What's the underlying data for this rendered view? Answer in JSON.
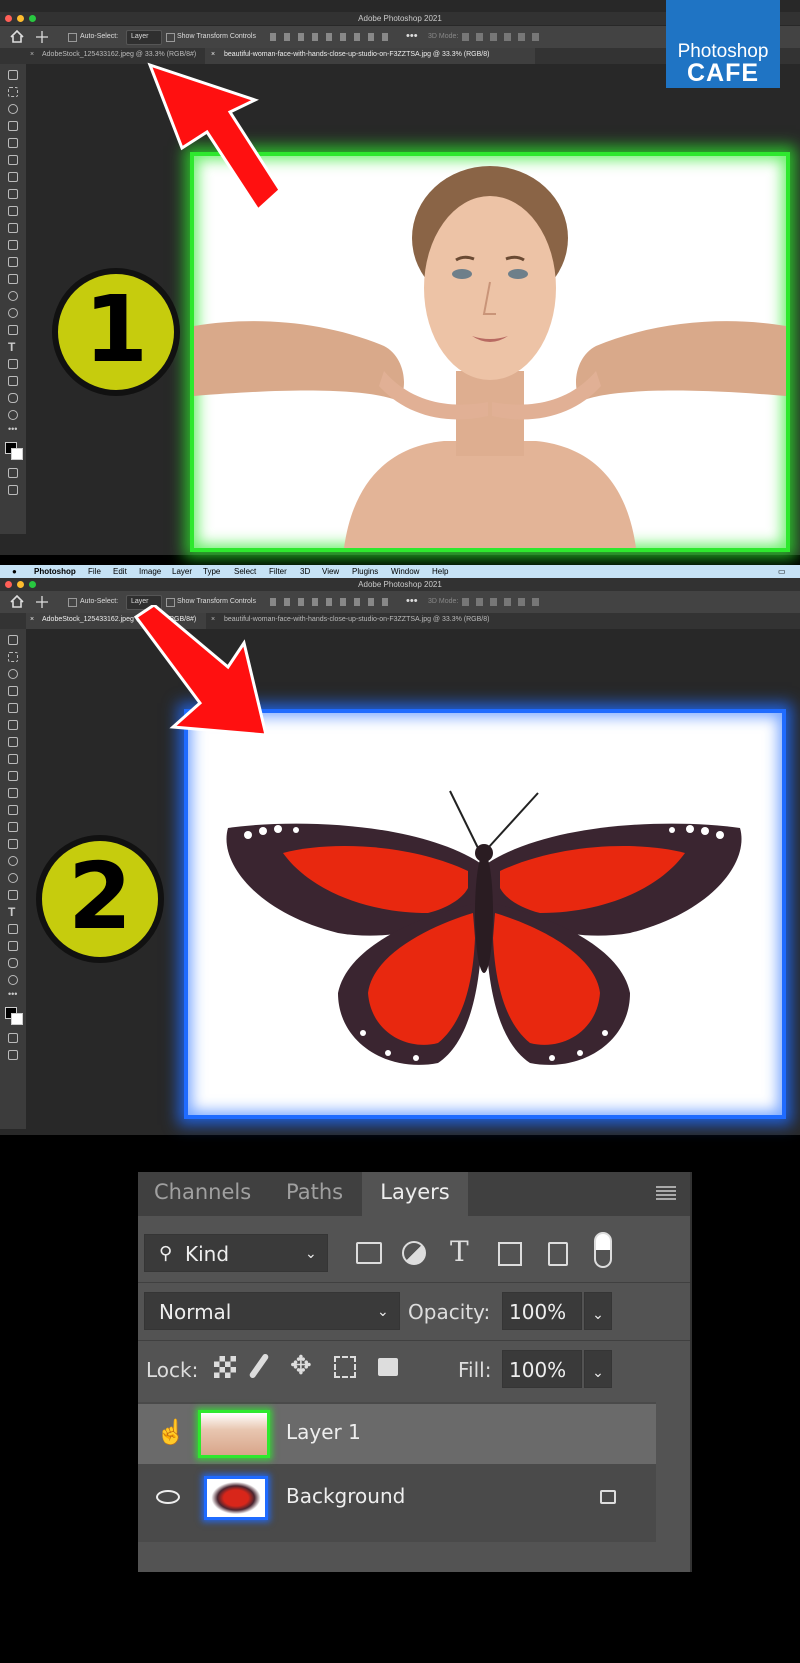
{
  "window_top": {
    "app_title": "Adobe Photoshop 2021",
    "options": {
      "auto_select_label": "Auto-Select:",
      "auto_select_value": "Layer",
      "show_transform_label": "Show Transform Controls",
      "mode_3d_label": "3D Mode:"
    },
    "tabs": [
      "AdobeStock_125433162.jpeg @ 33.3% (RGB/8#)",
      "beautiful-woman-face-with-hands-close-up-studio-on-F3ZZTSA.jpg @ 33.3% (RGB/8)"
    ],
    "active_tab": 1,
    "badge_number": "1",
    "canvas_content": "woman-portrait",
    "highlight_color": "#2ee82e"
  },
  "window_bottom": {
    "app_title": "Adobe Photoshop 2021",
    "menu": [
      "Photoshop",
      "File",
      "Edit",
      "Image",
      "Layer",
      "Type",
      "Select",
      "Filter",
      "3D",
      "View",
      "Plugins",
      "Window",
      "Help"
    ],
    "options": {
      "auto_select_label": "Auto-Select:",
      "auto_select_value": "Layer",
      "show_transform_label": "Show Transform Controls",
      "mode_3d_label": "3D Mode:"
    },
    "tabs": [
      "AdobeStock_125433162.jpeg @ 33.3% (RGB/8#)",
      "beautiful-woman-face-with-hands-close-up-studio-on-F3ZZTSA.jpg @ 33.3% (RGB/8)"
    ],
    "active_tab": 0,
    "badge_number": "2",
    "canvas_content": "butterfly",
    "highlight_color": "#1f6bff"
  },
  "logo": {
    "line1": "Photoshop",
    "line2": "CAFE",
    "bg": "#1f74c4"
  },
  "arrow_color": "#ff1010",
  "layers_panel": {
    "tabs": [
      "Channels",
      "Paths",
      "Layers"
    ],
    "active_tab": "Layers",
    "filter_kind": "Kind",
    "blend_mode": "Normal",
    "opacity_label": "Opacity:",
    "opacity_value": "100%",
    "lock_label": "Lock:",
    "fill_label": "Fill:",
    "fill_value": "100%",
    "layers": [
      {
        "name": "Layer 1",
        "visibility_icon": "hand-cursor-icon",
        "selected": true,
        "thumb_highlight": "#2ee82e"
      },
      {
        "name": "Background",
        "visibility_icon": "eye-icon",
        "locked": true,
        "selected": false,
        "thumb_highlight": "#1f6bff"
      }
    ]
  }
}
